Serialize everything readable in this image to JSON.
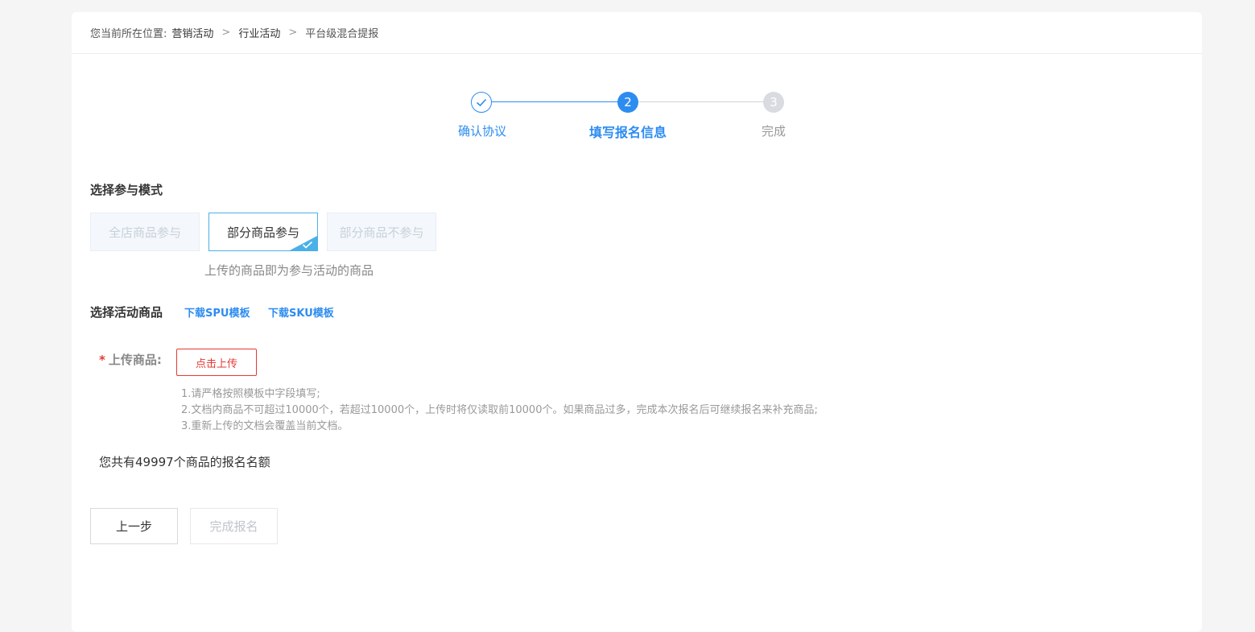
{
  "breadcrumb": {
    "prefix": "您当前所在位置:",
    "items": [
      "营销活动",
      "行业活动",
      "平台级混合提报"
    ],
    "separator": ">"
  },
  "steps": [
    {
      "label": "确认协议",
      "status": "done",
      "number": ""
    },
    {
      "label": "填写报名信息",
      "status": "active",
      "number": "2"
    },
    {
      "label": "完成",
      "status": "todo",
      "number": "3"
    }
  ],
  "mode": {
    "title": "选择参与模式",
    "options": [
      {
        "label": "全店商品参与",
        "selected": false
      },
      {
        "label": "部分商品参与",
        "selected": true
      },
      {
        "label": "部分商品不参与",
        "selected": false
      }
    ],
    "description": "上传的商品即为参与活动的商品"
  },
  "goods": {
    "title": "选择活动商品",
    "spu_link": "下载SPU模板",
    "sku_link": "下载SKU模板",
    "upload_label": "上传商品:",
    "required_mark": "*",
    "upload_button": "点击上传",
    "tips": [
      "1.请严格按照模板中字段填写;",
      "2.文档内商品不可超过10000个，若超过10000个，上传时将仅读取前10000个。如果商品过多，完成本次报名后可继续报名来补充商品;",
      "3.重新上传的文档会覆盖当前文档。"
    ],
    "quota_text": "您共有49997个商品的报名名额"
  },
  "actions": {
    "prev": "上一步",
    "finish": "完成报名"
  },
  "colors": {
    "primary": "#2d8cf0",
    "selected_border": "#4ab0e8",
    "danger": "#e53935"
  }
}
